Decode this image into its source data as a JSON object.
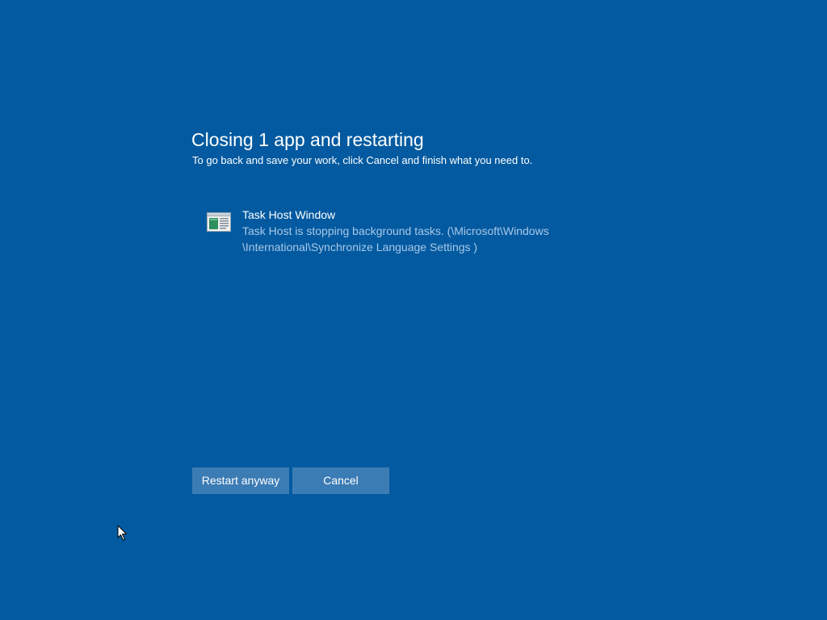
{
  "dialog": {
    "title": "Closing 1 app and restarting",
    "subtitle": "To go back and save your work, click Cancel and finish what you need to."
  },
  "apps": [
    {
      "name": "Task Host Window",
      "description_line1": "Task Host is stopping background tasks. (\\Microsoft\\Windows",
      "description_line2": "\\International\\Synchronize Language Settings )",
      "icon": "task-host-window-icon"
    }
  ],
  "buttons": {
    "restart_label": "Restart anyway",
    "cancel_label": "Cancel"
  },
  "colors": {
    "background": "#035aa0",
    "button": "#3c7cb5",
    "secondary_text": "#a8c8e8"
  }
}
